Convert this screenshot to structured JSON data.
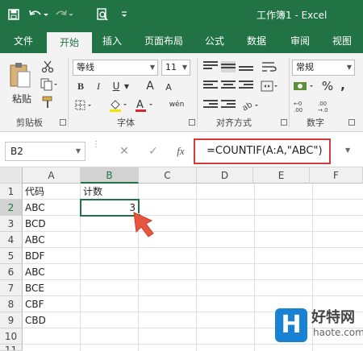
{
  "title_bar": {
    "title": "工作簿1 - Excel",
    "icons": [
      "save-icon",
      "undo-icon",
      "redo-icon",
      "print-preview-icon",
      "customize-qat-icon"
    ]
  },
  "tabs": [
    {
      "label": "文件",
      "active": false
    },
    {
      "label": "开始",
      "active": true
    },
    {
      "label": "插入",
      "active": false
    },
    {
      "label": "页面布局",
      "active": false
    },
    {
      "label": "公式",
      "active": false
    },
    {
      "label": "数据",
      "active": false
    },
    {
      "label": "审阅",
      "active": false
    },
    {
      "label": "视图",
      "active": false
    }
  ],
  "ribbon": {
    "clipboard": {
      "paste_label": "粘贴",
      "group_label": "剪贴板"
    },
    "font": {
      "font_name": "等线",
      "font_size": "11",
      "bold": "B",
      "italic": "I",
      "underline": "U",
      "grow_font": "A",
      "shrink_font": "A",
      "phonetic": "wén",
      "group_label": "字体"
    },
    "alignment": {
      "group_label": "对齐方式"
    },
    "number": {
      "format": "常规",
      "percent": "%",
      "comma": ",",
      "group_label": "数字"
    }
  },
  "formula_bar": {
    "name_box": "B2",
    "cancel": "✕",
    "enter": "✓",
    "fx": "fx",
    "formula": "=COUNTIF(A:A,\"ABC\")"
  },
  "sheet": {
    "columns": [
      "A",
      "B",
      "C",
      "D",
      "E",
      "F"
    ],
    "rows": [
      "1",
      "2",
      "3",
      "4",
      "5",
      "6",
      "7",
      "8",
      "9",
      "10",
      "11"
    ],
    "cells": {
      "A1": "代码",
      "B1": "计数",
      "A2": "ABC",
      "B2": "3",
      "A3": "BCD",
      "A4": "ABC",
      "A5": "BDF",
      "A6": "ABC",
      "A7": "BCE",
      "A8": "CBF",
      "A9": "CBD"
    },
    "active_cell": "B2"
  },
  "watermark": {
    "logo": "H",
    "name": "好特网",
    "url": "haote.com"
  },
  "colors": {
    "excel_green": "#217346",
    "highlight_red": "#d03b3b",
    "arrow_red": "#e8553f"
  }
}
